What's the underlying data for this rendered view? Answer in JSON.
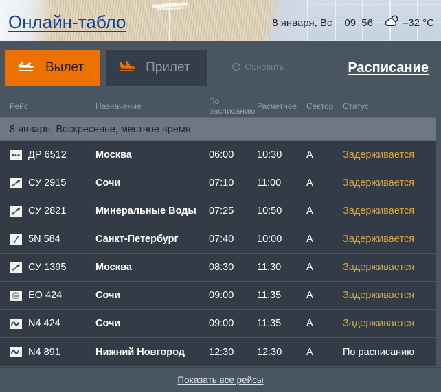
{
  "header": {
    "title": "Онлайн-табло",
    "date": "8 января, Вс",
    "time_hours": "09",
    "time_colon": ":",
    "time_minutes": "56",
    "weather_icon": "cloud-sun-icon",
    "temperature": "–32 °C"
  },
  "toolbar": {
    "tab_departure": "Вылет",
    "tab_departure_icon": "plane-takeoff-icon",
    "tab_arrival": "Прилет",
    "tab_arrival_icon": "plane-landing-icon",
    "refresh_label": "Обновить",
    "refresh_icon": "refresh-circle-icon",
    "schedule_link": "Расписание"
  },
  "table": {
    "columns": {
      "flight": "Рейс",
      "destination": "Назначение",
      "scheduled": "По расписанию",
      "estimated": "Расчетное",
      "sector": "Сектор",
      "status": "Статус"
    },
    "section_label": "8 января, Воскресенье, местное время",
    "rows": [
      {
        "logo": "three-dots-logo-icon",
        "flight": "ДР 6512",
        "destination": "Москва",
        "scheduled": "06:00",
        "estimated": "10:30",
        "sector": "А",
        "status": "Задерживается",
        "status_type": "delayed"
      },
      {
        "logo": "plane-diagonal-logo-icon",
        "flight": "СУ 2915",
        "destination": "Сочи",
        "scheduled": "07:10",
        "estimated": "11:00",
        "sector": "А",
        "status": "Задерживается",
        "status_type": "delayed"
      },
      {
        "logo": "plane-diagonal-logo-icon",
        "flight": "СУ 2821",
        "destination": "Минеральные Воды",
        "scheduled": "07:25",
        "estimated": "10:50",
        "sector": "А",
        "status": "Задерживается",
        "status_type": "delayed"
      },
      {
        "logo": "plane-small-logo-icon",
        "flight": "5N 584",
        "destination": "Санкт-Петербург",
        "scheduled": "07:40",
        "estimated": "10:00",
        "sector": "А",
        "status": "Задерживается",
        "status_type": "delayed"
      },
      {
        "logo": "plane-diagonal-logo-icon",
        "flight": "СУ 1395",
        "destination": "Москва",
        "scheduled": "08:30",
        "estimated": "11:30",
        "sector": "А",
        "status": "Задерживается",
        "status_type": "delayed"
      },
      {
        "logo": "circle-c-logo-icon",
        "flight": "ЕО 424",
        "destination": "Сочи",
        "scheduled": "09:00",
        "estimated": "11:35",
        "sector": "А",
        "status": "Задерживается",
        "status_type": "delayed"
      },
      {
        "logo": "wave-logo-icon",
        "flight": "N4 424",
        "destination": "Сочи",
        "scheduled": "09:00",
        "estimated": "11:35",
        "sector": "А",
        "status": "Задерживается",
        "status_type": "delayed"
      },
      {
        "logo": "wave-logo-icon",
        "flight": "N4 891",
        "destination": "Нижний Новгород",
        "scheduled": "12:30",
        "estimated": "12:30",
        "sector": "А",
        "status": "По расписанию",
        "status_type": "ontime"
      }
    ]
  },
  "footer": {
    "show_all_link": "Показать все рейсы"
  },
  "colors": {
    "accent_orange": "#ed7100",
    "title_blue": "#11419a",
    "status_delayed": "#d8a43c",
    "row_bg": "#333b47",
    "panel_bg": "#4a5562",
    "band_bg": "#6e7884"
  }
}
